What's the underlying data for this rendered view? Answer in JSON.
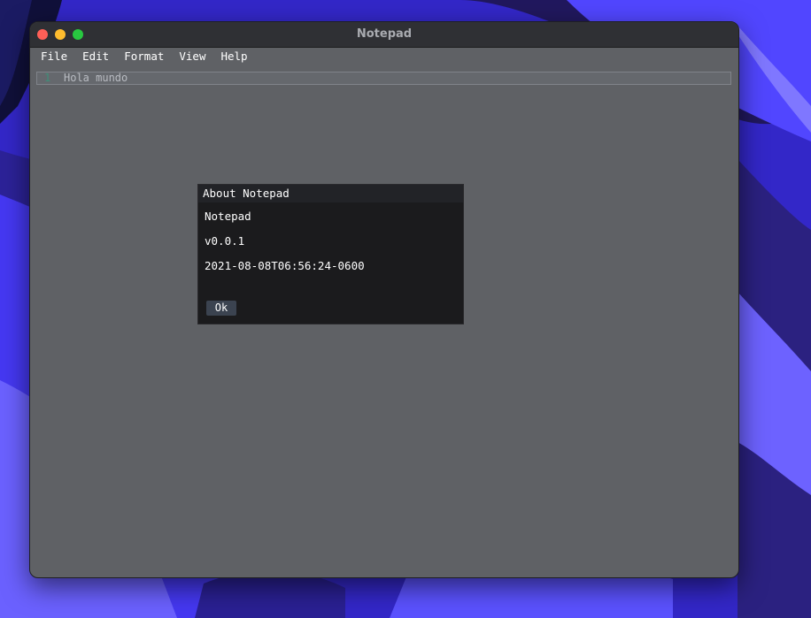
{
  "window": {
    "title": "Notepad"
  },
  "menubar": {
    "items": [
      {
        "label": "File"
      },
      {
        "label": "Edit"
      },
      {
        "label": "Format"
      },
      {
        "label": "View"
      },
      {
        "label": "Help"
      }
    ]
  },
  "editor": {
    "lines": [
      {
        "number": "1",
        "text": "Hola mundo"
      }
    ]
  },
  "about_dialog": {
    "title": "About Notepad",
    "app_name": "Notepad",
    "version": "v0.0.1",
    "build_date": "2021-08-08T06:56:24-0600",
    "ok_label": "Ok"
  },
  "colors": {
    "desktop_accent": "#3a2fd8",
    "window_background": "#5f6165",
    "titlebar": "#2f3034",
    "dialog_background": "#1b1b1d",
    "close": "#ff5f57",
    "minimize": "#febc2e",
    "zoom": "#28c840"
  }
}
